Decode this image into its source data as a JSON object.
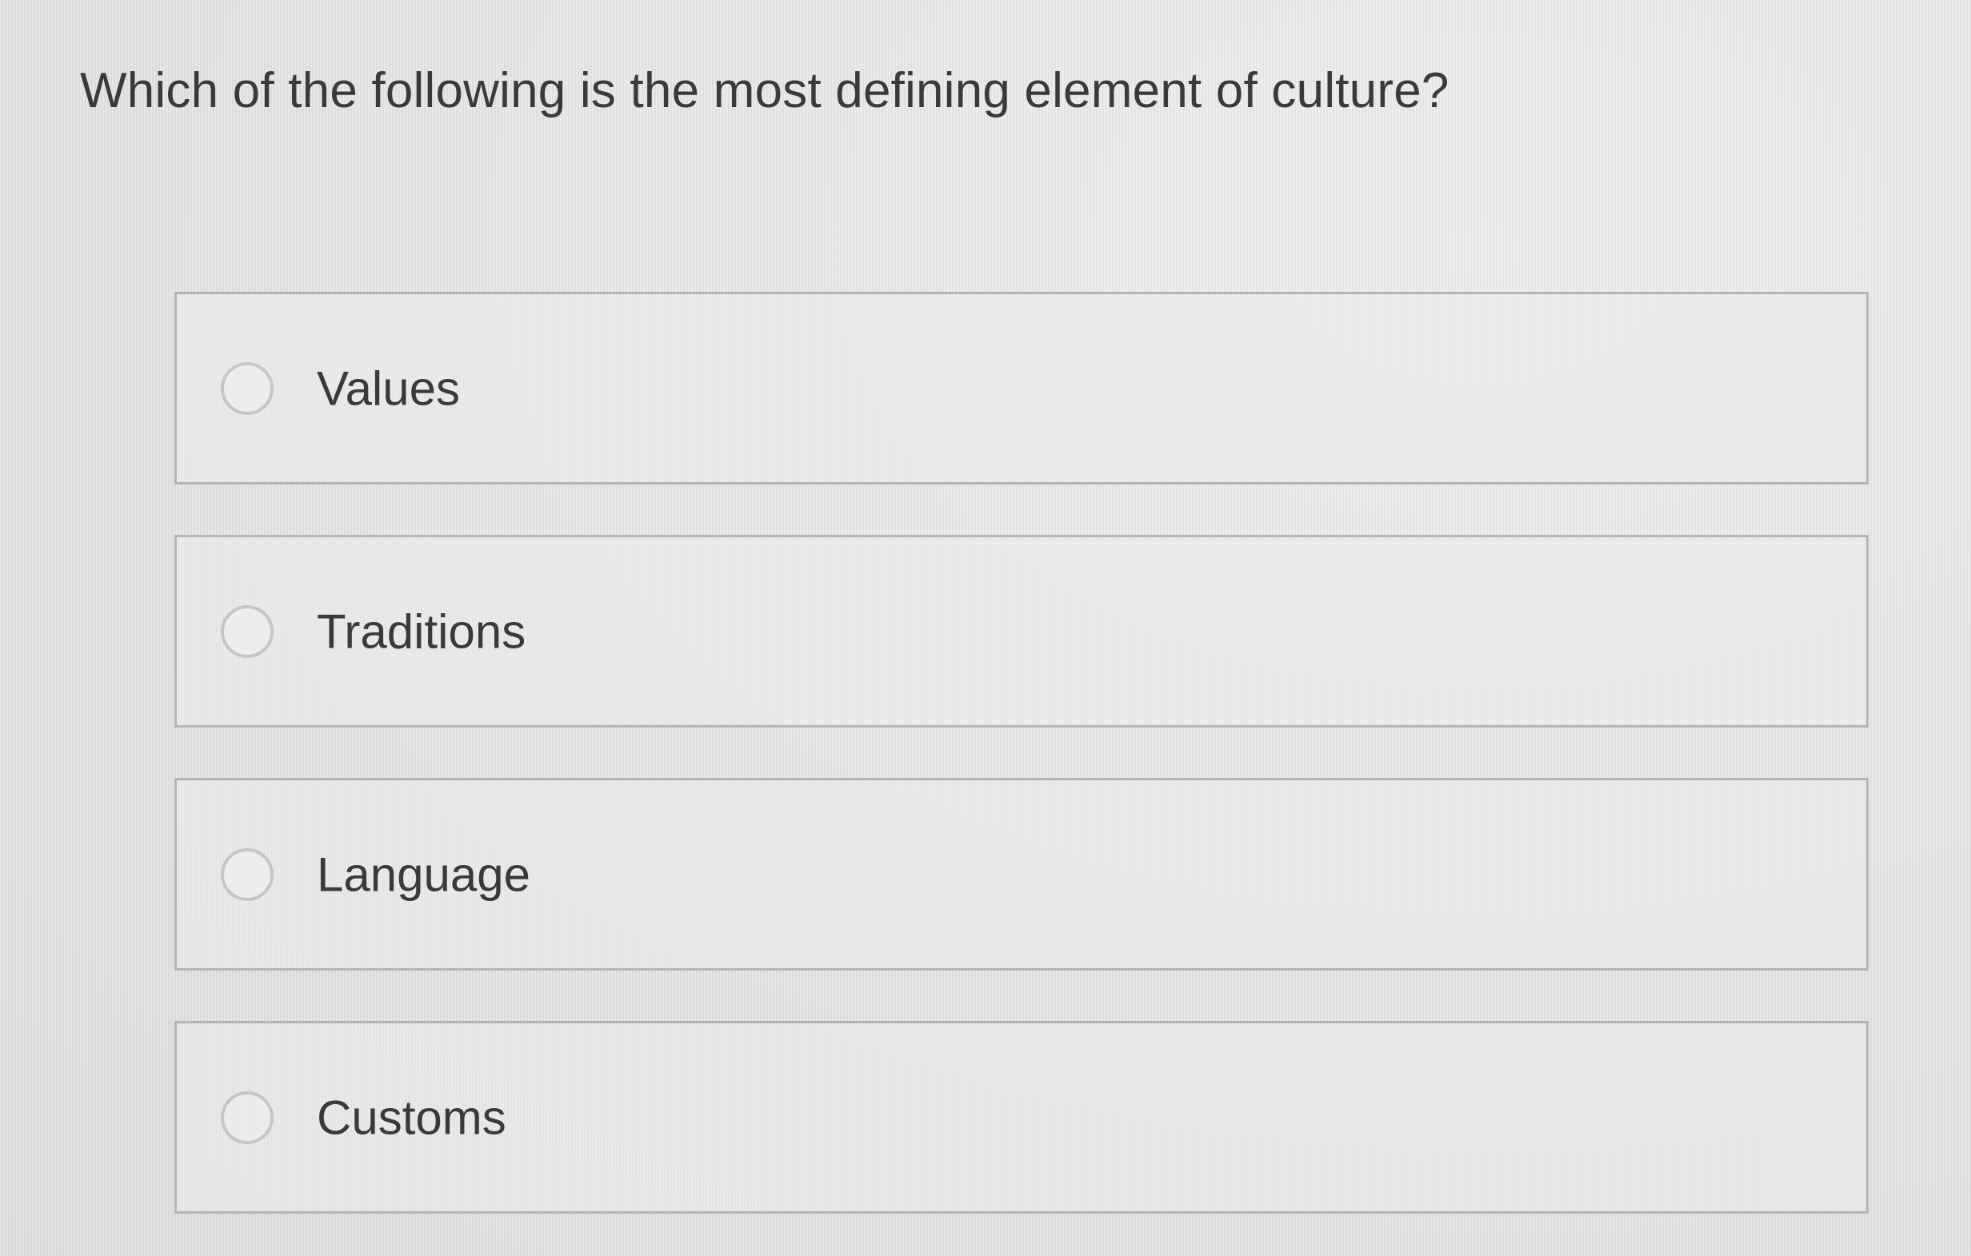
{
  "question": {
    "text": "Which of the following is the most defining element of culture?"
  },
  "options": [
    {
      "label": "Values",
      "selected": false
    },
    {
      "label": "Traditions",
      "selected": false
    },
    {
      "label": "Language",
      "selected": false
    },
    {
      "label": "Customs",
      "selected": false
    }
  ],
  "colors": {
    "background": "#e4e4e4",
    "border": "#b5b5b5",
    "text": "#3a3a3a",
    "radio_border": "#c6c6c6"
  }
}
